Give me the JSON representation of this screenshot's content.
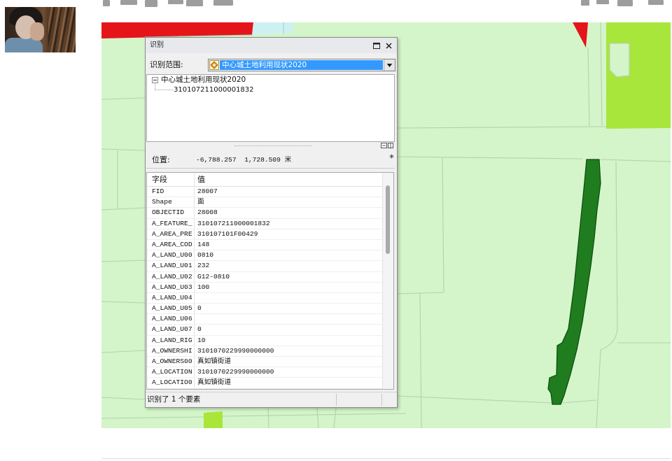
{
  "avatar": {
    "icon": "user-avatar-photo"
  },
  "map": {
    "colors": {
      "background": "#d3f5c9",
      "parcel_line": "#b6cfb0",
      "dark_parcel": "#1f7d1f",
      "dark_parcel_border": "#0e4a0e",
      "red_parcel": "#e5141b",
      "lime_parcel": "#a8e63c",
      "water": "#cdf1f3"
    }
  },
  "identify": {
    "title": "识别",
    "icons": {
      "dock": "dock-window-icon",
      "close": "close-icon",
      "layer": "layer-diamond-icon",
      "dropdown": "chevron-down-icon",
      "collapse": "tree-collapse-icon"
    },
    "scope": {
      "label": "识别范围:",
      "selected": "中心城土地利用现状2020",
      "highlight_color": "#3399ff"
    },
    "tree": {
      "layer": "中心城土地利用现状2020",
      "feature": "310107211000001832"
    },
    "location": {
      "label": "位置:",
      "value": "-6,788.257  1,728.509 米"
    },
    "table": {
      "headers": {
        "field": "字段",
        "value": "值"
      },
      "rows": [
        {
          "field": "FID",
          "value": "28007"
        },
        {
          "field": "Shape",
          "value": "面"
        },
        {
          "field": "OBJECTID",
          "value": "28008"
        },
        {
          "field": "A_FEATURE_",
          "value": "310107211000001832"
        },
        {
          "field": "A_AREA_PRE",
          "value": "310107101F00429"
        },
        {
          "field": "A_AREA_COD",
          "value": "148"
        },
        {
          "field": "A_LAND_U00",
          "value": "0810"
        },
        {
          "field": "A_LAND_U01",
          "value": "232"
        },
        {
          "field": "A_LAND_U02",
          "value": "G12-0810"
        },
        {
          "field": "A_LAND_U03",
          "value": "100"
        },
        {
          "field": "A_LAND_U04",
          "value": ""
        },
        {
          "field": "A_LAND_U05",
          "value": "0"
        },
        {
          "field": "A_LAND_U06",
          "value": ""
        },
        {
          "field": "A_LAND_U07",
          "value": "0"
        },
        {
          "field": "A_LAND_RIG",
          "value": "10"
        },
        {
          "field": "A_OWNERSHI",
          "value": "3101070229990000000"
        },
        {
          "field": "A_OWNERS00",
          "value": "真如镇街道"
        },
        {
          "field": "A_LOCATION",
          "value": "3101070229990000000"
        },
        {
          "field": "A_LOCATIO0",
          "value": "真如镇街道"
        }
      ]
    },
    "status": "识别了 1 个要素"
  }
}
